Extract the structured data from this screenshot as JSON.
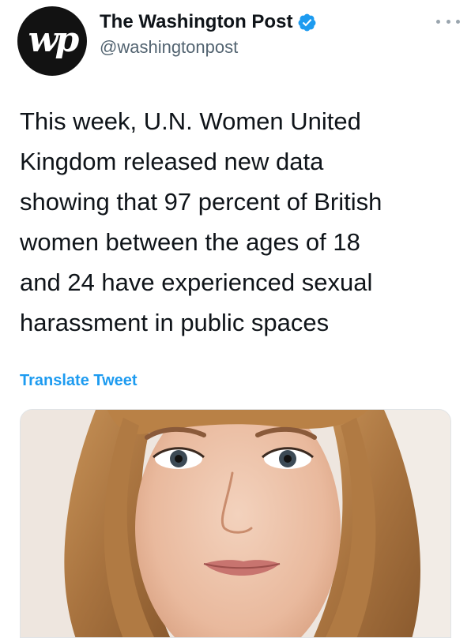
{
  "author": {
    "display_name": "The Washington Post",
    "handle": "@washingtonpost",
    "avatar_text": "wp",
    "verified": true,
    "verified_icon": "verified-badge-icon"
  },
  "tweet": {
    "text": "This week, U.N. Women United\nKingdom released new data\nshowing that 97 percent of British\nwomen between the ages of 18\nand 24 have experienced sexual\nharassment in public spaces",
    "translate_label": "Translate Tweet"
  },
  "media": {
    "type": "photo",
    "description_icon": "portrait-photo"
  },
  "colors": {
    "accent": "#1d9bf0",
    "text": "#0f1419",
    "secondary": "#536471"
  }
}
